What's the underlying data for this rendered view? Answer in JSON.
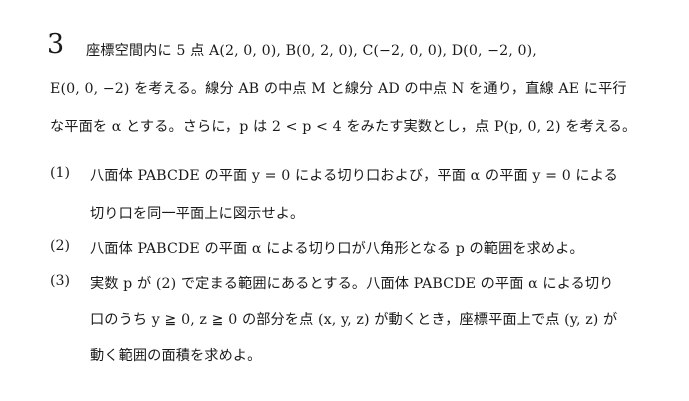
{
  "problem": {
    "number": "3",
    "intro": [
      "座標空間内に 5 点 A(2, 0, 0), B(0, 2, 0), C(−2, 0, 0), D(0, −2, 0),",
      "E(0, 0, −2) を考える。線分 AB の中点 M と線分 AD の中点 N を通り，直線 AE に平行",
      "な平面を α とする。さらに，p は 2 < p < 4 をみたす実数とし，点 P(p, 0, 2) を考える。"
    ],
    "questions": [
      {
        "label": "(1)",
        "lines": [
          "八面体 PABCDE の平面 y = 0 による切り口および，平面 α の平面 y = 0 による",
          "切り口を同一平面上に図示せよ。"
        ]
      },
      {
        "label": "(2)",
        "lines": [
          "八面体 PABCDE の平面 α による切り口が八角形となる p の範囲を求めよ。"
        ]
      },
      {
        "label": "(3)",
        "lines": [
          "実数 p が (2) で定まる範囲にあるとする。八面体 PABCDE の平面 α による切り",
          "口のうち y ≧ 0, z ≧ 0 の部分を点 (x, y, z) が動くとき，座標平面上で点 (y, z) が",
          "動く範囲の面積を求めよ。"
        ]
      }
    ]
  }
}
